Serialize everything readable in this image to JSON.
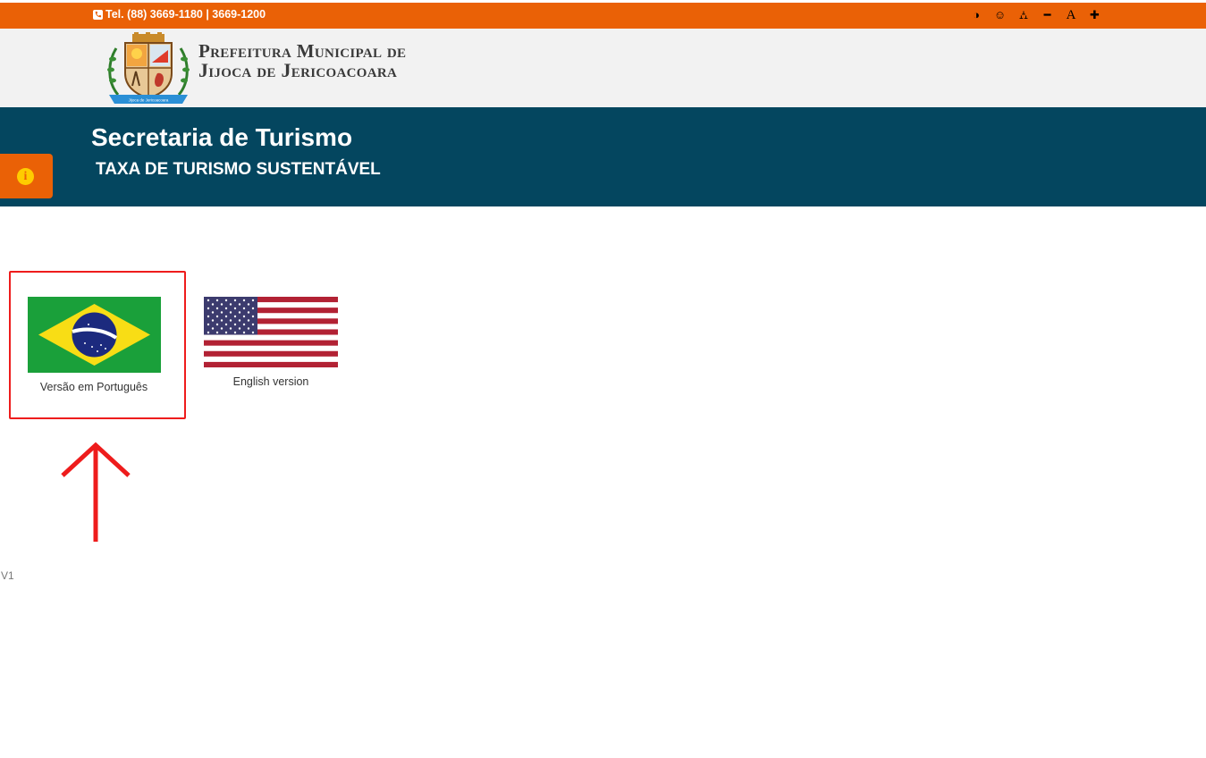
{
  "topbar": {
    "phone": "Tel. (88) 3669-1180 | 3669-1200",
    "accessibility": {
      "contrast_icon": "◑",
      "face_icon": "☺",
      "sitemap_icon": "⛼",
      "decrease_label": "━",
      "font_label": "A",
      "increase_label": "✚"
    },
    "color": "#ea6106"
  },
  "header": {
    "brand_line1": "Prefeitura Municipal de",
    "brand_line2": "Jijoca de Jericoacoara",
    "crest_ribbon": "Jijoca de Jericoacoara"
  },
  "banner": {
    "title": "Secretaria de Turismo",
    "subtitle": "TAXA DE TURISMO SUSTENTÁVEL",
    "color": "#04465f"
  },
  "info_tab": {
    "icon": "i"
  },
  "languages": [
    {
      "label": "Versão em Português",
      "flag": "brazil-flag"
    },
    {
      "label": "English version",
      "flag": "usa-flag"
    }
  ],
  "annotation": {
    "highlight_color": "#ee1c1c"
  },
  "footer": {
    "version": "V1"
  }
}
